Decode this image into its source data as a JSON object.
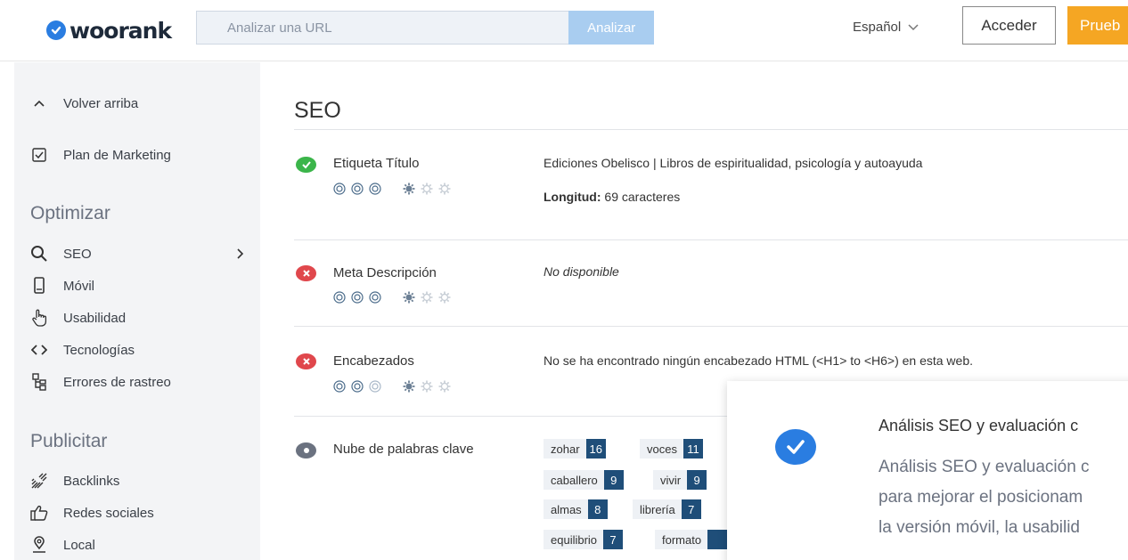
{
  "header": {
    "logo_text": "woorank",
    "search_placeholder": "Analizar una URL",
    "search_button": "Analizar",
    "language": "Español",
    "login_button": "Acceder",
    "try_button": "Prueb"
  },
  "sidebar": {
    "back_to_top": "Volver arriba",
    "marketing_plan": "Plan de Marketing",
    "optimize_heading": "Optimizar",
    "optimize_items": [
      {
        "label": "SEO",
        "icon": "search-icon"
      },
      {
        "label": "Móvil",
        "icon": "mobile-icon"
      },
      {
        "label": "Usabilidad",
        "icon": "hand-pointer-icon"
      },
      {
        "label": "Tecnologías",
        "icon": "code-icon"
      },
      {
        "label": "Errores de rastreo",
        "icon": "sitemap-icon"
      }
    ],
    "publish_heading": "Publicitar",
    "publish_items": [
      {
        "label": "Backlinks",
        "icon": "backlinks-icon"
      },
      {
        "label": "Redes sociales",
        "icon": "thumbs-up-icon"
      },
      {
        "label": "Local",
        "icon": "location-icon"
      }
    ]
  },
  "main": {
    "section_title": "SEO",
    "rows": [
      {
        "status": "ok",
        "label": "Etiqueta Título",
        "text": "Ediciones Obelisco | Libros de espiritualidad, psicología y autoayuda",
        "detail_label": "Longitud:",
        "detail_value": " 69 caracteres"
      },
      {
        "status": "fail",
        "label": "Meta Descripción",
        "text": "No disponible"
      },
      {
        "status": "fail",
        "label": "Encabezados",
        "text": "No se ha encontrado ningún encabezado HTML (<H1> to <H6>) en esta web."
      },
      {
        "status": "info",
        "label": "Nube de palabras clave"
      }
    ],
    "keywords": [
      {
        "word": "zohar",
        "count": "16"
      },
      {
        "word": "voces",
        "count": "11"
      },
      {
        "word": "caballero",
        "count": "9"
      },
      {
        "word": "vivir",
        "count": "9"
      },
      {
        "word": "almas",
        "count": "8"
      },
      {
        "word": "librería",
        "count": "7"
      },
      {
        "word": "equilibrio",
        "count": "7"
      },
      {
        "word": "formato",
        "count": ""
      }
    ]
  },
  "popup": {
    "title": "Análisis SEO y evaluación c",
    "body_line1": "Análisis SEO y evaluación c",
    "body_line2": "para mejorar el posicionam",
    "body_line3": "la versión móvil, la usabilid"
  },
  "colors": {
    "accent_blue": "#2a7de1",
    "try_orange": "#f5a623",
    "ok_green": "#3bb54a",
    "fail_red": "#e0474c",
    "tag_count_navy": "#1f4e79"
  }
}
